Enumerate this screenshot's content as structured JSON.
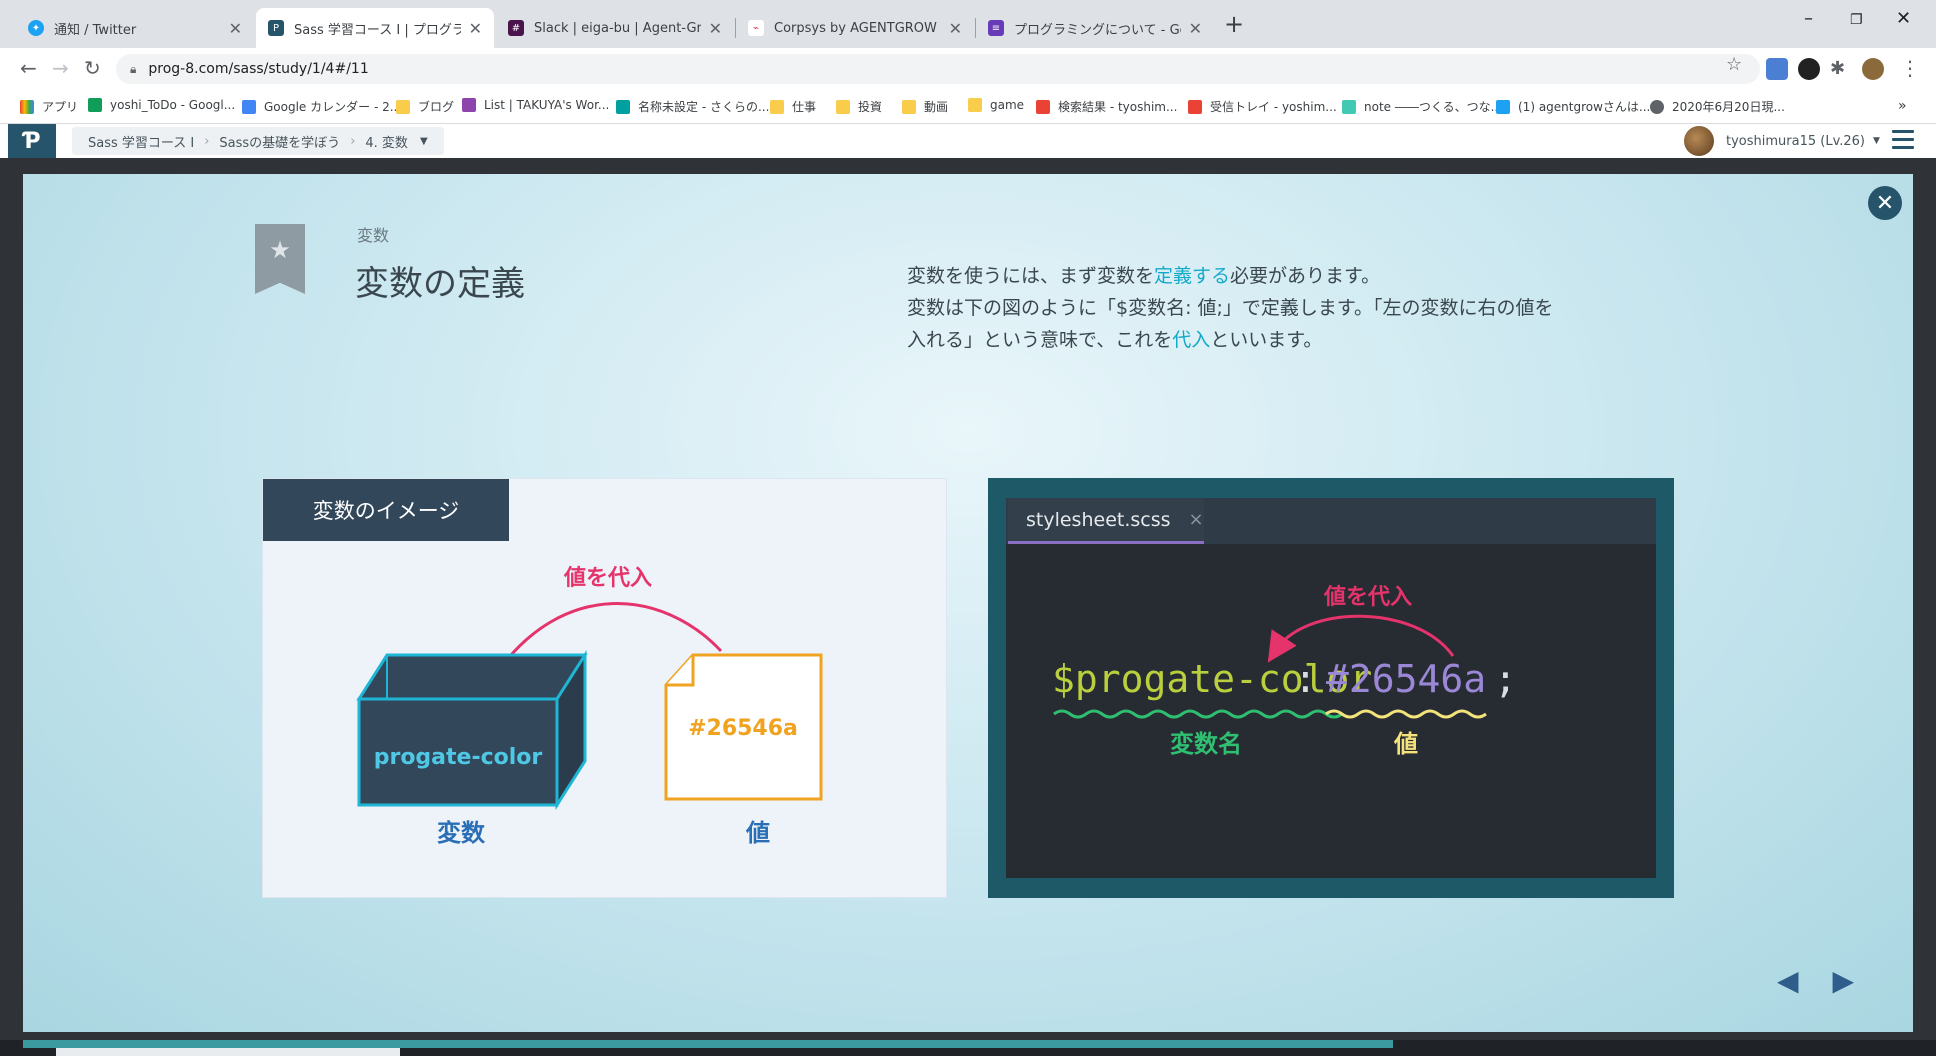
{
  "browser": {
    "tabs": [
      {
        "label": "通知 / Twitter",
        "color": "#1da1f2"
      },
      {
        "label": "Sass 学習コース I | プログラミングの入",
        "color": "#26546a"
      },
      {
        "label": "Slack | eiga-bu | Agent-Grow",
        "color": "#4a154b"
      },
      {
        "label": "Corpsys by AGENTGROW Inc.",
        "color": "#e23b5a"
      },
      {
        "label": "プログラミングについて - Google フォー",
        "color": "#673ab7"
      }
    ],
    "url": "prog-8.com/sass/study/1/4#/11",
    "bookmarks": [
      {
        "label": "アプリ",
        "color": "#ea4335"
      },
      {
        "label": "yoshi_ToDo - Googl...",
        "color": "#0f9d58"
      },
      {
        "label": "Google カレンダー - 2...",
        "color": "#4285f4"
      },
      {
        "label": "ブログ",
        "color": "#f9cc4b"
      },
      {
        "label": "List | TAKUYA's Wor...",
        "color": "#8e44ad"
      },
      {
        "label": "名称未設定 - さくらの...",
        "color": "#00a0a0"
      },
      {
        "label": "仕事",
        "color": "#f9cc4b"
      },
      {
        "label": "投資",
        "color": "#f9cc4b"
      },
      {
        "label": "動画",
        "color": "#f9cc4b"
      },
      {
        "label": "game",
        "color": "#f9cc4b"
      },
      {
        "label": "検索結果 - tyoshim...",
        "color": "#ea4335"
      },
      {
        "label": "受信トレイ - yoshim...",
        "color": "#ea4335"
      },
      {
        "label": "note ――つくる、つな...",
        "color": "#41c9b4"
      },
      {
        "label": "(1) agentgrowさんは...",
        "color": "#1da1f2"
      },
      {
        "label": "2020年6月20日現...",
        "color": "#5f6368"
      }
    ]
  },
  "app": {
    "breadcrumbs": [
      "Sass 学習コース I",
      "Sassの基礎を学ぼう",
      "4. 変数"
    ],
    "user": "tyoshimura15 (Lv.26)"
  },
  "slide": {
    "section": "変数",
    "title": "変数の定義",
    "desc": {
      "l1a": "変数を使うには、まず変数を",
      "l1b": "定義する",
      "l1c": "必要があります。",
      "l2": "変数は下の図のように「$変数名: 値;」で定義します。「左の変数に右の値を",
      "l3a": "入れる」という意味で、これを",
      "l3b": "代入",
      "l3c": "といいます。"
    },
    "image_panel": {
      "tag": "変数のイメージ",
      "assign_label": "値を代入",
      "box_text": "progate-color",
      "box_caption": "変数",
      "paper_text": "#26546a",
      "paper_caption": "値"
    },
    "code_panel": {
      "tab": "stylesheet.scss",
      "tab_close": "×",
      "assign_label": "値を代入",
      "var": "$progate-color",
      "colon": ":",
      "value": "#26546a",
      "semicolon": ";",
      "var_caption": "変数名",
      "value_caption": "値"
    }
  }
}
